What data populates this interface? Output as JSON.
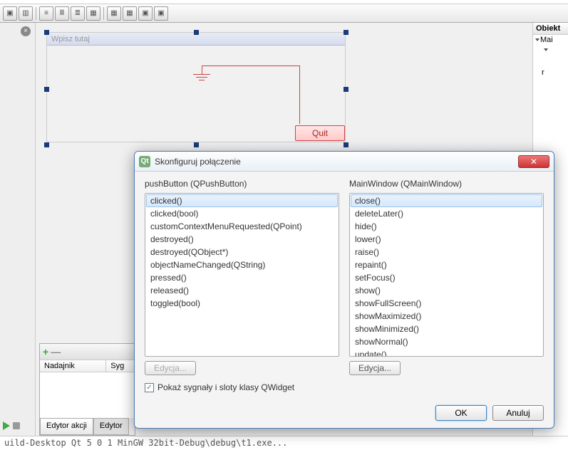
{
  "menubar_hint": "…",
  "menustrip_placeholder": "Wpisz tutaj",
  "quit_label": "Quit",
  "right_panel": {
    "header": "Obiekt",
    "item1": "Mai",
    "item2": "r"
  },
  "bottom_panel": {
    "col1": "Nadajnik",
    "col2": "Syg",
    "tab_active": "Edytor akcji",
    "tab_inactive": "Edytor"
  },
  "dialog": {
    "title": "Skonfiguruj połączenie",
    "left_label": "pushButton (QPushButton)",
    "right_label": "MainWindow (QMainWindow)",
    "signals": [
      "clicked()",
      "clicked(bool)",
      "customContextMenuRequested(QPoint)",
      "destroyed()",
      "destroyed(QObject*)",
      "objectNameChanged(QString)",
      "pressed()",
      "released()",
      "toggled(bool)"
    ],
    "slots": [
      "close()",
      "deleteLater()",
      "hide()",
      "lower()",
      "raise()",
      "repaint()",
      "setFocus()",
      "show()",
      "showFullScreen()",
      "showMaximized()",
      "showMinimized()",
      "showNormal()",
      "update()"
    ],
    "selected_signal": "clicked()",
    "selected_slot": "close()",
    "edit_left": "Edycja...",
    "edit_right": "Edycja...",
    "checkbox_label": "Pokaż sygnały i sloty klasy QWidget",
    "checkbox_checked": true,
    "ok": "OK",
    "cancel": "Anuluj"
  },
  "status_text": "uild-Desktop Qt 5 0 1 MinGW 32bit-Debug\\debug\\t1.exe..."
}
